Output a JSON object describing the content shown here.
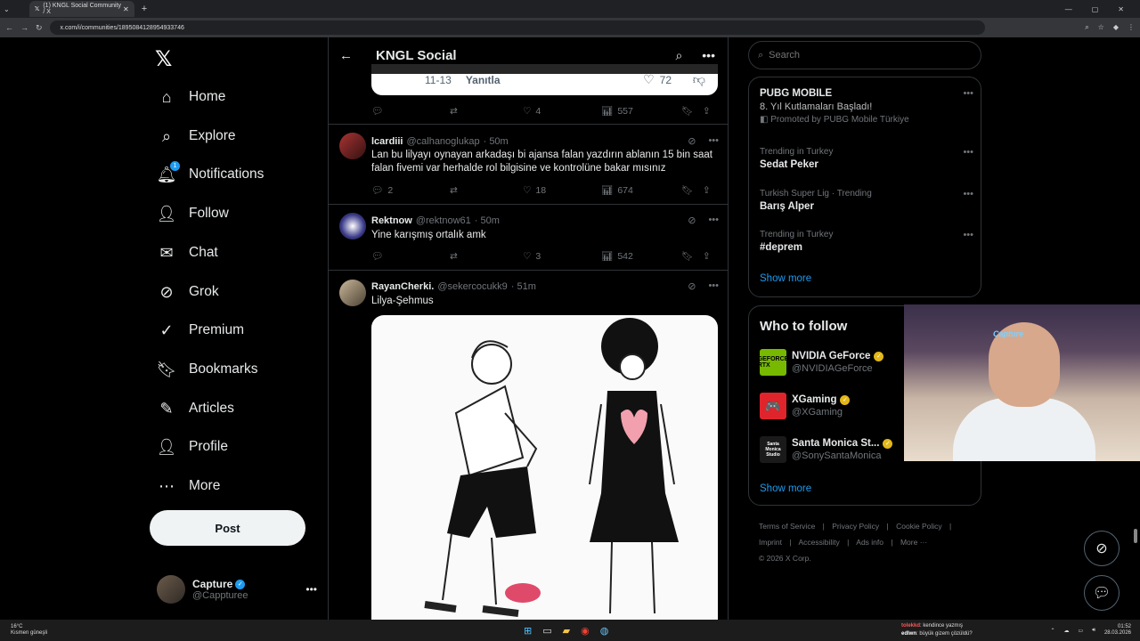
{
  "browser": {
    "tab_title": "(1) KNGL Social Community / X",
    "url": "x.com/i/communities/1895084128954933746"
  },
  "leftnav": {
    "items": [
      {
        "label": "Home"
      },
      {
        "label": "Explore"
      },
      {
        "label": "Notifications",
        "badge": "1"
      },
      {
        "label": "Follow"
      },
      {
        "label": "Chat"
      },
      {
        "label": "Grok"
      },
      {
        "label": "Premium"
      },
      {
        "label": "Bookmarks"
      },
      {
        "label": "Articles"
      },
      {
        "label": "Profile"
      },
      {
        "label": "More"
      }
    ],
    "post_label": "Post",
    "account": {
      "name": "Capture",
      "handle": "@Cappturee"
    }
  },
  "main": {
    "title": "KNGL Social",
    "quote": {
      "time": "11-13",
      "reply": "Yanıtla",
      "likes": "72"
    },
    "first_actions": {
      "replies": "",
      "retweets": "",
      "likes": "4",
      "views": "557"
    },
    "tweets": [
      {
        "name": "lcardiii",
        "handle": "@calhanoglukap",
        "time": "· 50m",
        "text": "Lan bu lilyayı oynayan arkadaşı bi ajansa falan yazdırın ablanın 15 bin saat falan fivemi var herhalde rol bilgisine ve kontrolüne bakar mısınız",
        "replies": "2",
        "retweets": "",
        "likes": "18",
        "views": "674"
      },
      {
        "name": "Rektnow",
        "handle": "@rektnow61",
        "time": "· 50m",
        "text": "Yine karışmış ortalık amk",
        "replies": "",
        "retweets": "",
        "likes": "3",
        "views": "542"
      },
      {
        "name": "RayanCherki.",
        "handle": "@sekercocukk9",
        "time": "· 51m",
        "text": "Lilya-Şehmus"
      }
    ]
  },
  "right": {
    "search_placeholder": "Search",
    "promo": {
      "title": "PUBG MOBILE",
      "subtitle": "8. Yıl Kutlamaları Başladı!",
      "promoted": "Promoted by PUBG Mobile Türkiye"
    },
    "trends": [
      {
        "meta": "Trending in Turkey",
        "title": "Sedat Peker"
      },
      {
        "meta": "Turkish Super Lig · Trending",
        "title": "Barış Alper"
      },
      {
        "meta": "Trending in Turkey",
        "title": "#deprem"
      }
    ],
    "show_more": "Show more",
    "who_to_follow": {
      "title": "Who to follow",
      "accounts": [
        {
          "name": "NVIDIA GeForce",
          "handle": "@NVIDIAGeForce",
          "avatar_text": "GEFORCE RTX",
          "color": "#76b900"
        },
        {
          "name": "XGaming",
          "handle": "@XGaming",
          "avatar_text": "🎮",
          "color": "#e0242c"
        },
        {
          "name": "Santa Monica St...",
          "handle": "@SonySantaMonica",
          "avatar_text": "Santa Monica Studio",
          "color": "#1a1a1a"
        }
      ],
      "show_more": "Show more"
    },
    "footer": [
      "Terms of Service",
      "|",
      "Privacy Policy",
      "|",
      "Cookie Policy",
      "|",
      "Imprint",
      "|",
      "Accessibility",
      "|",
      "Ads info",
      "|",
      "More ···",
      "© 2026 X Corp."
    ]
  },
  "webcam": {
    "neon_text": "Capture"
  },
  "taskbar": {
    "weather_temp": "16°C",
    "weather_desc": "Kısmen güneşli",
    "chat_line1_user": "tolekkd",
    "chat_line1_msg": ": kendince yazmış",
    "chat_line2_user": "edlwn",
    "chat_line2_msg": ": büyük gizem çözüldü?",
    "time": "01:52",
    "date": "28.03.2026"
  }
}
